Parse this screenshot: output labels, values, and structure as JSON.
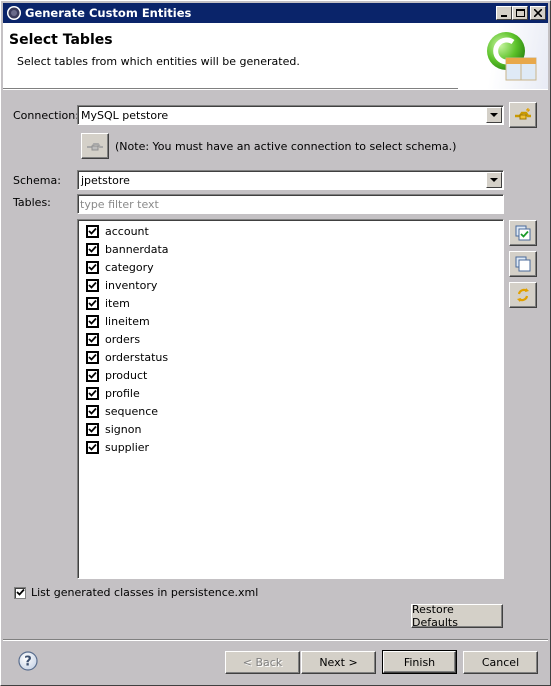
{
  "window": {
    "title": "Generate Custom Entities",
    "controls": {
      "minimize": "_",
      "maximize": "□",
      "close": "×"
    }
  },
  "header": {
    "title": "Select Tables",
    "description": "Select tables from which entities will be generated.",
    "banner_icon": "entity-table-icon"
  },
  "connection": {
    "label": "Connection:",
    "value": "MySQL petstore",
    "connect_button_icon": "connect-plug-icon",
    "reconnect_button_icon": "disconnected-plug-icon",
    "note": "(Note: You must have an active connection to select schema.)"
  },
  "schema": {
    "label": "Schema:",
    "value": "jpetstore"
  },
  "tables": {
    "label": "Tables:",
    "filter_placeholder": "type filter text",
    "items": [
      {
        "name": "account",
        "checked": true
      },
      {
        "name": "bannerdata",
        "checked": true
      },
      {
        "name": "category",
        "checked": true
      },
      {
        "name": "inventory",
        "checked": true
      },
      {
        "name": "item",
        "checked": true
      },
      {
        "name": "lineitem",
        "checked": true
      },
      {
        "name": "orders",
        "checked": true
      },
      {
        "name": "orderstatus",
        "checked": true
      },
      {
        "name": "product",
        "checked": true
      },
      {
        "name": "profile",
        "checked": true
      },
      {
        "name": "sequence",
        "checked": true
      },
      {
        "name": "signon",
        "checked": true
      },
      {
        "name": "supplier",
        "checked": true
      }
    ],
    "side_buttons": [
      "select-all-icon",
      "deselect-all-icon",
      "refresh-icon"
    ]
  },
  "options": {
    "persistence_label": "List generated classes in persistence.xml",
    "persistence_checked": true,
    "restore_defaults": "Restore Defaults"
  },
  "footer": {
    "help_icon": "help-icon",
    "back": "< Back",
    "next": "Next >",
    "finish": "Finish",
    "cancel": "Cancel"
  }
}
